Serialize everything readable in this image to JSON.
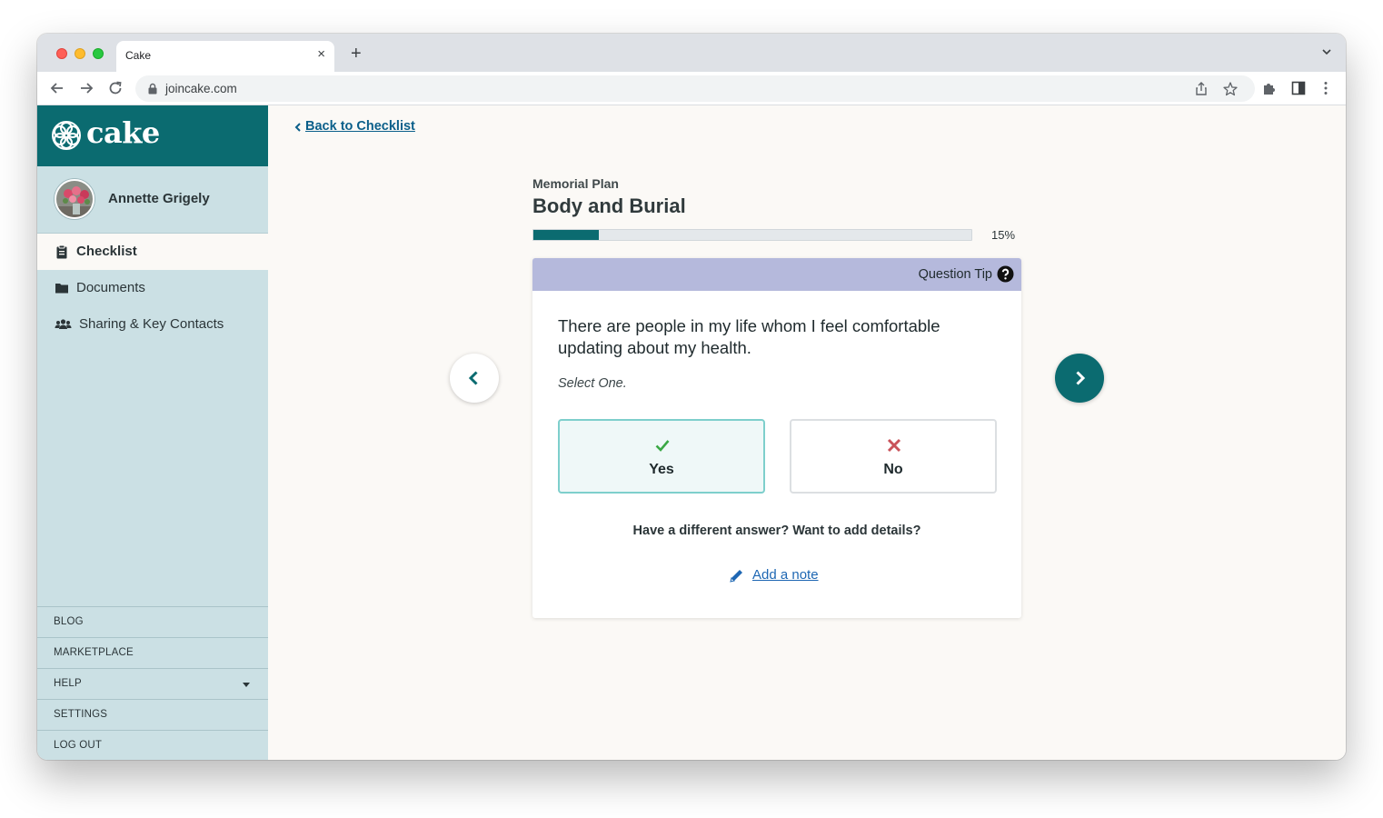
{
  "browser": {
    "tab_title": "Cake",
    "tab_close": "×",
    "new_tab": "+",
    "url": "joincake.com"
  },
  "sidebar": {
    "logo_text": "cake",
    "user_name": "Annette Grigely",
    "nav": [
      {
        "label": "Checklist",
        "icon": "clipboard-icon",
        "active": true
      },
      {
        "label": "Documents",
        "icon": "folder-icon",
        "active": false
      },
      {
        "label": "Sharing & Key Contacts",
        "icon": "users-icon",
        "active": false
      }
    ],
    "footer": [
      {
        "label": "BLOG"
      },
      {
        "label": "MARKETPLACE"
      },
      {
        "label": "HELP",
        "has_dropdown": true
      },
      {
        "label": "SETTINGS"
      },
      {
        "label": "LOG OUT"
      }
    ]
  },
  "main": {
    "back_link": "Back to Checklist",
    "kicker": "Memorial Plan",
    "title": "Body and Burial",
    "progress": {
      "value": 0.15,
      "label": "15%"
    },
    "card": {
      "tip_label": "Question Tip",
      "question": "There are people in my life whom I feel comfortable updating about my health.",
      "instruction": "Select One.",
      "choices": [
        {
          "label": "Yes",
          "icon": "check-icon",
          "selected": true
        },
        {
          "label": "No",
          "icon": "x-icon",
          "selected": false
        }
      ],
      "helper": "Have a different answer? Want to add details?",
      "add_note": "Add a note"
    }
  },
  "colors": {
    "brand_teal": "#0b6b70",
    "sidebar_bg": "#cbe0e4",
    "tip_bar": "#b5b9dc",
    "selected_border": "#7ecfcc",
    "check_green": "#3aa845",
    "x_red": "#c9525a",
    "link_blue": "#1e67b3"
  }
}
